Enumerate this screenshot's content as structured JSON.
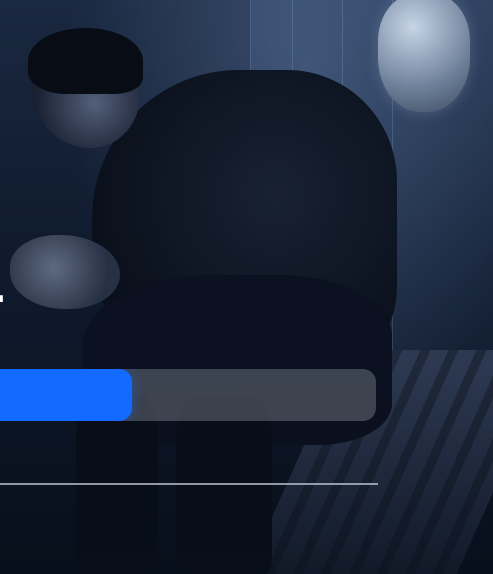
{
  "screen": {
    "edge_text": "L"
  },
  "progress": {
    "value": 0.39
  },
  "colors": {
    "progress_fill": "#126aff",
    "progress_track": "#787d87",
    "divider": "#b0b7c2",
    "background": "#0f1a2d"
  },
  "icons": {
    "background_photo": "man-in-locker-room-image"
  }
}
